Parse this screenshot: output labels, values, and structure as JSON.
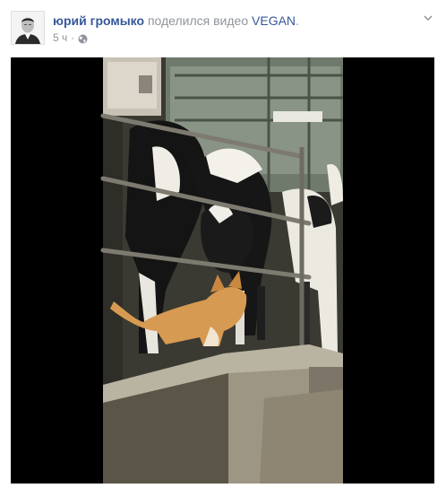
{
  "post": {
    "author": "юрий громыко",
    "action": "поделился видео",
    "page_name": "VEGAN",
    "period": ".",
    "time": "5 ч",
    "icons": {
      "privacy": "globe-icon",
      "menu": "chevron-down-icon"
    }
  },
  "video": {
    "scene": "cat-and-cows-video-frame"
  },
  "colors": {
    "link": "#365899",
    "meta": "#90949c",
    "video_bg": "#000000"
  }
}
